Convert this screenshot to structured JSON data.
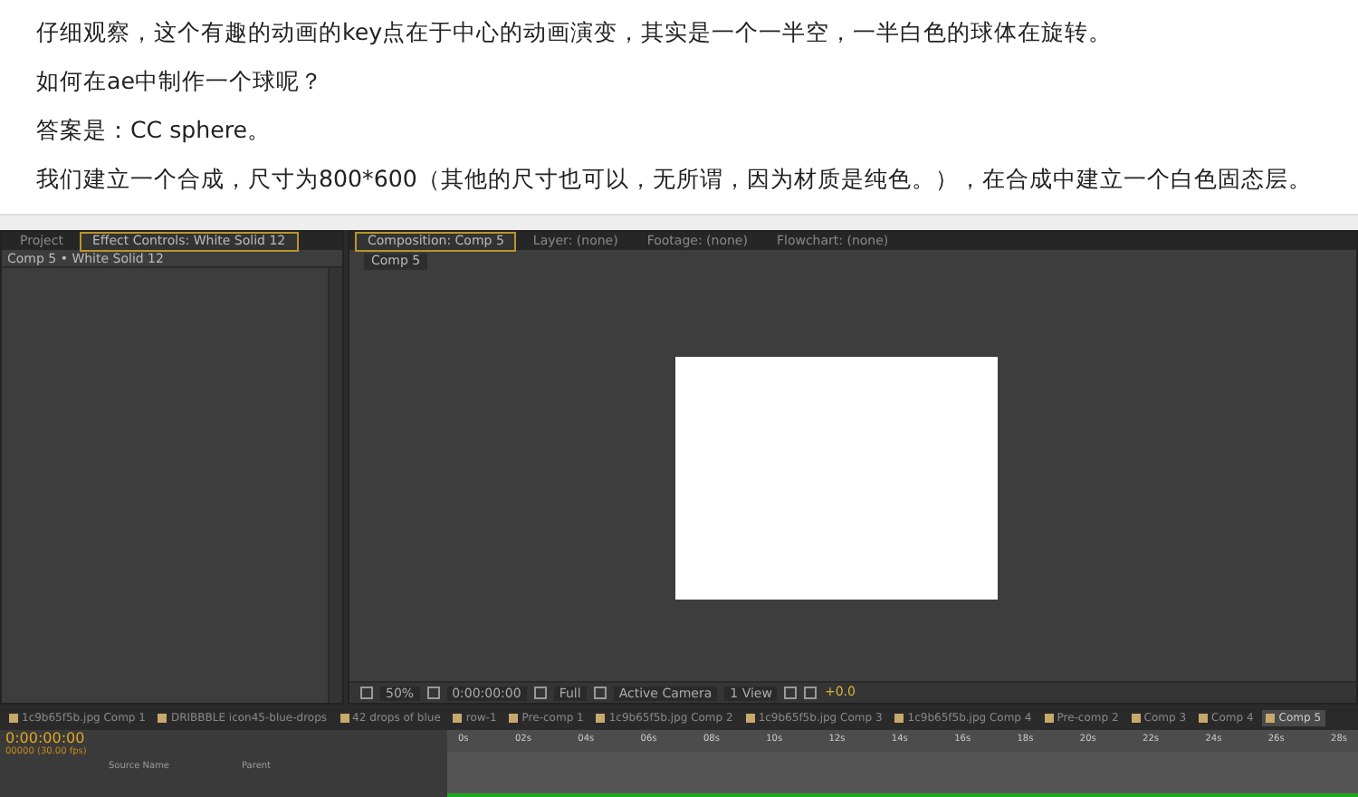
{
  "article": {
    "paragraphs": [
      "仔细观察，这个有趣的动画的key点在于中心的动画演变，其实是一个一半空，一半白色的球体在旋转。",
      "如何在ae中制作一个球呢？",
      "答案是：CC sphere。",
      "我们建立一个合成，尺寸为800*600（其他的尺寸也可以，无所谓，因为材质是纯色。），在合成中建立一个白色固态层。"
    ]
  },
  "ae_window": {
    "left_panel": {
      "tabs": [
        {
          "label": "Project",
          "selected": false
        },
        {
          "label": "Effect Controls: White Solid 12",
          "selected": true
        }
      ],
      "breadcrumb": "Comp 5 • White Solid 12"
    },
    "viewer_panel": {
      "tabs": [
        {
          "label": "Composition: Comp 5",
          "selected": true
        },
        {
          "label": "Layer: (none)",
          "selected": false
        },
        {
          "label": "Footage: (none)",
          "selected": false
        },
        {
          "label": "Flowchart: (none)",
          "selected": false
        }
      ],
      "comp_button": "Comp 5",
      "toolbar": {
        "zoom": "50%",
        "timecode": "0:00:00:00",
        "resolution": "Full",
        "camera": "Active Camera",
        "views": "1 View",
        "exposure": "+0.0"
      }
    },
    "timeline_tabs": [
      {
        "label": "1c9b65f5b.jpg Comp 1",
        "selected": false
      },
      {
        "label": "DRIBBBLE icon45-blue-drops",
        "selected": false
      },
      {
        "label": "42 drops of blue",
        "selected": false
      },
      {
        "label": "row-1",
        "selected": false
      },
      {
        "label": "Pre-comp 1",
        "selected": false
      },
      {
        "label": "1c9b65f5b.jpg Comp 2",
        "selected": false
      },
      {
        "label": "1c9b65f5b.jpg Comp 3",
        "selected": false
      },
      {
        "label": "1c9b65f5b.jpg Comp 4",
        "selected": false
      },
      {
        "label": "Pre-comp 2",
        "selected": false
      },
      {
        "label": "Comp 3",
        "selected": false
      },
      {
        "label": "Comp 4",
        "selected": false
      },
      {
        "label": "Comp 5",
        "selected": true
      }
    ],
    "timeline": {
      "timecode": "0:00:00:00",
      "fps": "00000 (30.00 fps)",
      "columns": [
        "Source Name",
        "Parent"
      ],
      "ruler": [
        "0s",
        "02s",
        "04s",
        "06s",
        "08s",
        "10s",
        "12s",
        "14s",
        "16s",
        "18s",
        "20s",
        "22s",
        "24s",
        "26s",
        "28s"
      ]
    }
  }
}
